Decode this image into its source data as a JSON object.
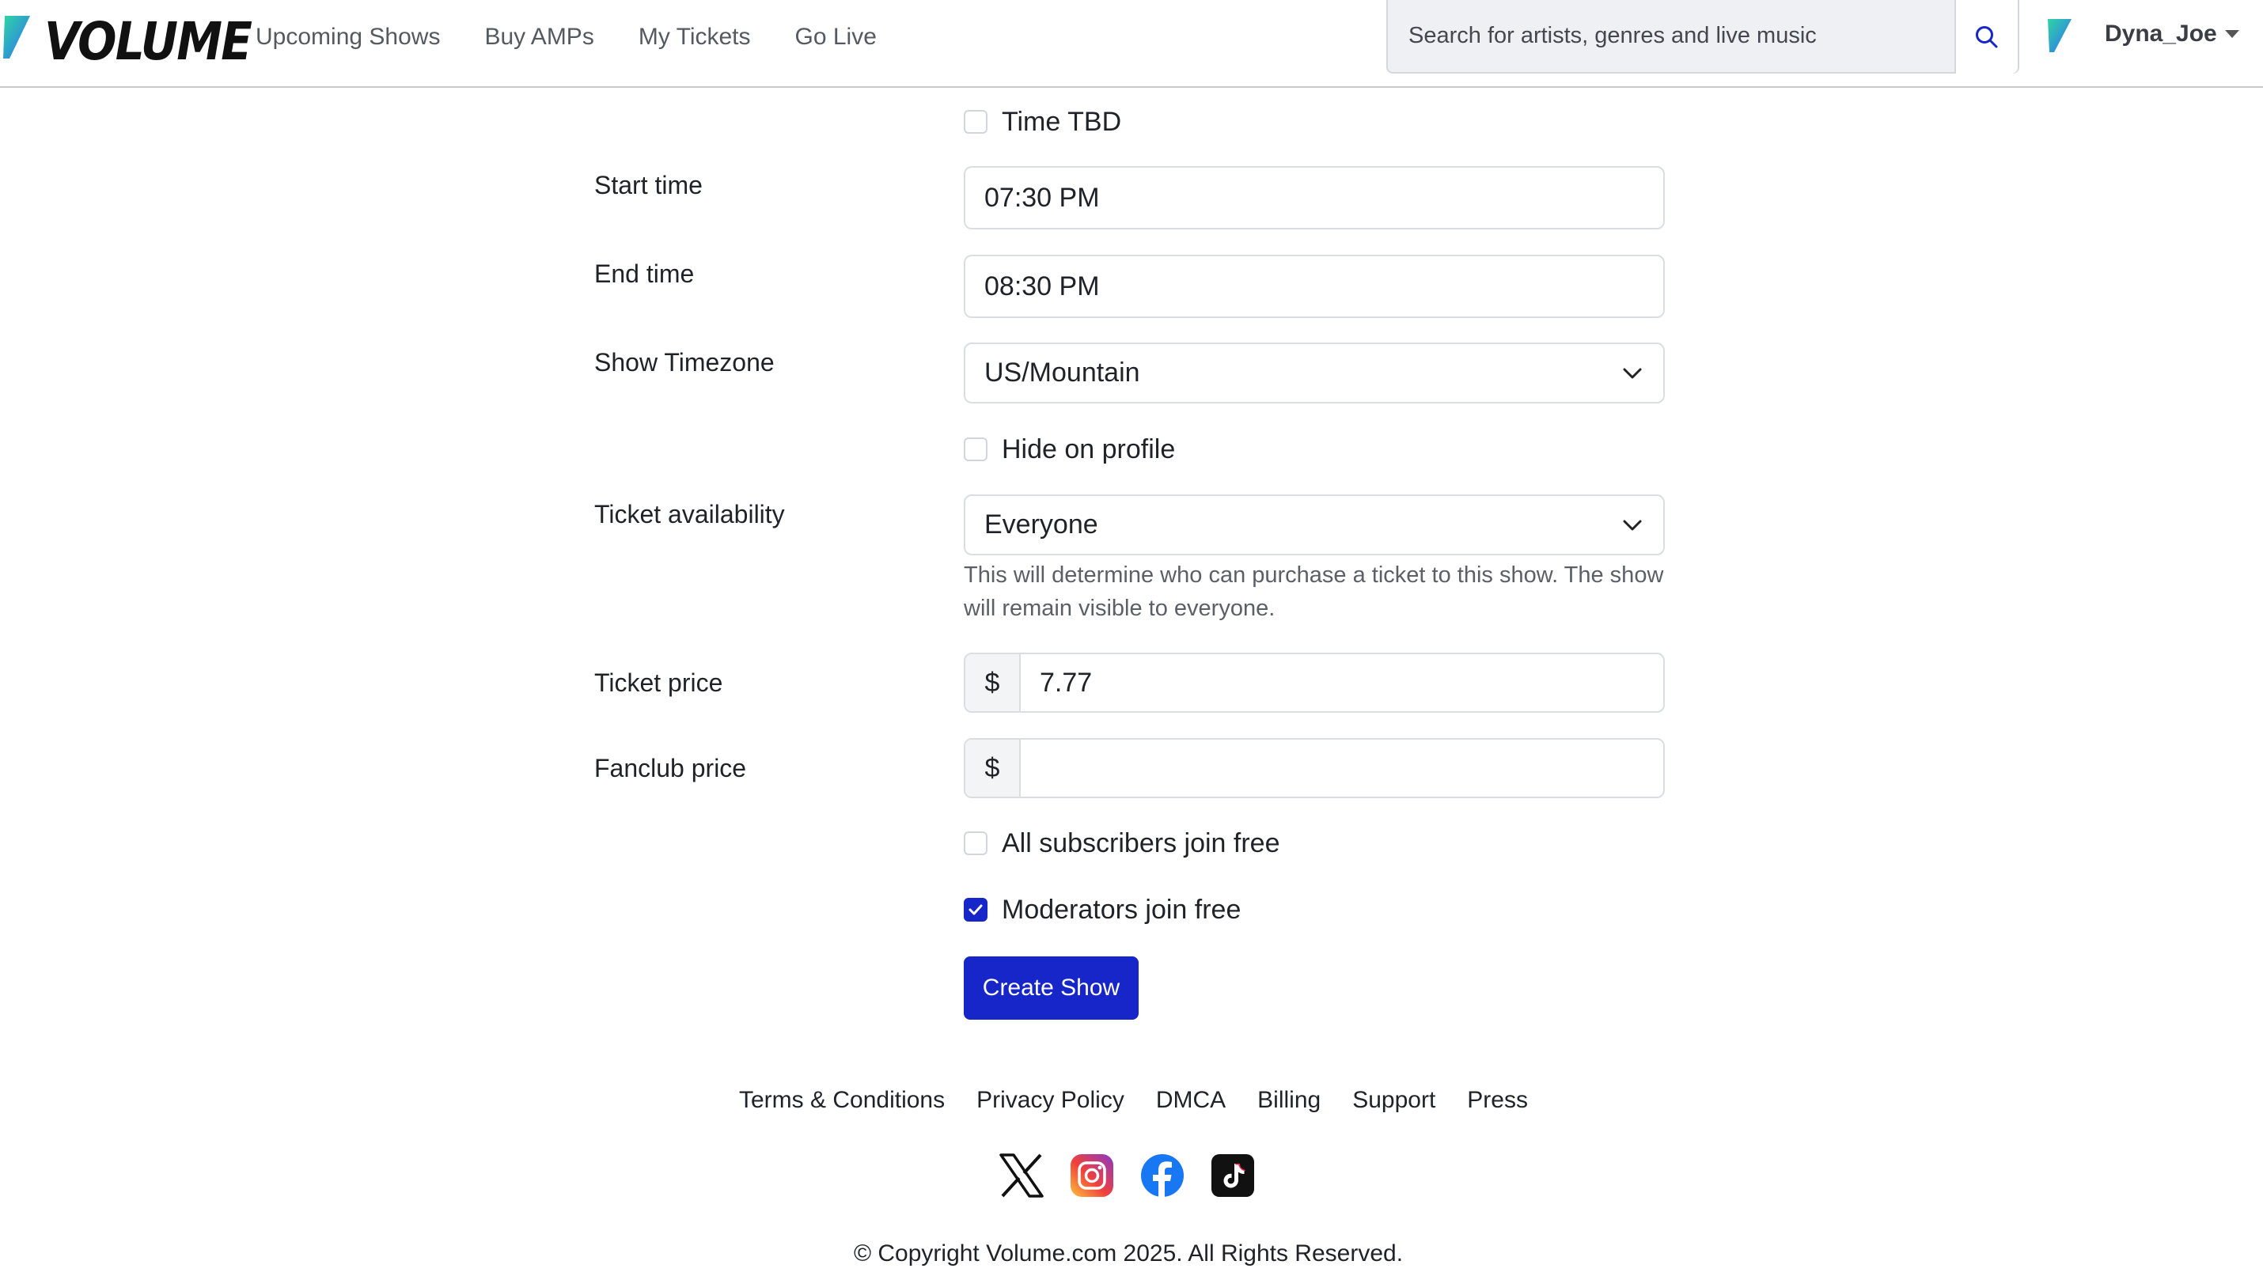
{
  "header": {
    "brand": "VOLUME",
    "nav": [
      {
        "label": "Upcoming Shows"
      },
      {
        "label": "Buy AMPs"
      },
      {
        "label": "My Tickets"
      },
      {
        "label": "Go Live"
      }
    ],
    "search_placeholder": "Search for artists, genres and live music",
    "username": "Dyna_Joe"
  },
  "form": {
    "time_tbd": {
      "label": "Time TBD",
      "checked": false
    },
    "start_time": {
      "label": "Start time",
      "value": "07:30 PM"
    },
    "end_time": {
      "label": "End time",
      "value": "08:30 PM"
    },
    "timezone": {
      "label": "Show Timezone",
      "value": "US/Mountain"
    },
    "hide_on_profile": {
      "label": "Hide on profile",
      "checked": false
    },
    "ticket_availability": {
      "label": "Ticket availability",
      "value": "Everyone",
      "help": "This will determine who can purchase a ticket to this show. The show will remain visible to everyone."
    },
    "ticket_price": {
      "label": "Ticket price",
      "currency": "$",
      "value": "7.77"
    },
    "fanclub_price": {
      "label": "Fanclub price",
      "currency": "$",
      "value": ""
    },
    "subscribers_free": {
      "label": "All subscribers join free",
      "checked": false
    },
    "moderators_free": {
      "label": "Moderators join free",
      "checked": true
    },
    "submit_label": "Create Show"
  },
  "footer": {
    "links": [
      {
        "label": "Terms & Conditions"
      },
      {
        "label": "Privacy Policy"
      },
      {
        "label": "DMCA"
      },
      {
        "label": "Billing"
      },
      {
        "label": "Support"
      },
      {
        "label": "Press"
      }
    ],
    "socials": [
      "x-icon",
      "instagram-icon",
      "facebook-icon",
      "tiktok-icon"
    ],
    "copyright": "© Copyright Volume.com 2025. All Rights Reserved."
  },
  "colors": {
    "primary": "#1726c9",
    "brand_gradient": [
      "#2fd6a3",
      "#2f6cf6"
    ]
  }
}
